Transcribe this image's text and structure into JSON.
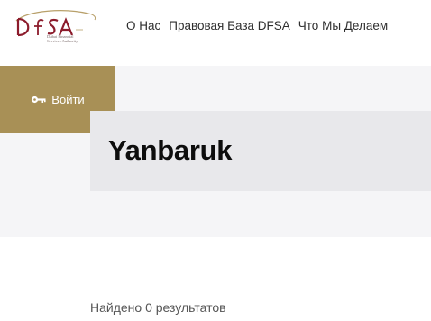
{
  "brand": {
    "logo_text": "DFSA",
    "logo_subtitle": [
      "Dubai Financial",
      "Services Authority"
    ]
  },
  "nav": {
    "items": [
      {
        "label": "О Нас"
      },
      {
        "label": "Правовая База DFSA"
      },
      {
        "label": "Что Мы Делаем"
      }
    ]
  },
  "login": {
    "label": "Войти",
    "icon": "key-icon"
  },
  "page": {
    "title": "Yanbaruk"
  },
  "results": {
    "summary": "Найдено 0 результатов"
  },
  "colors": {
    "accent_gold": "#a89056",
    "logo_red": "#8c1c2c",
    "band_bg": "#f5f5f7",
    "card_bg": "#e8e8eb"
  }
}
